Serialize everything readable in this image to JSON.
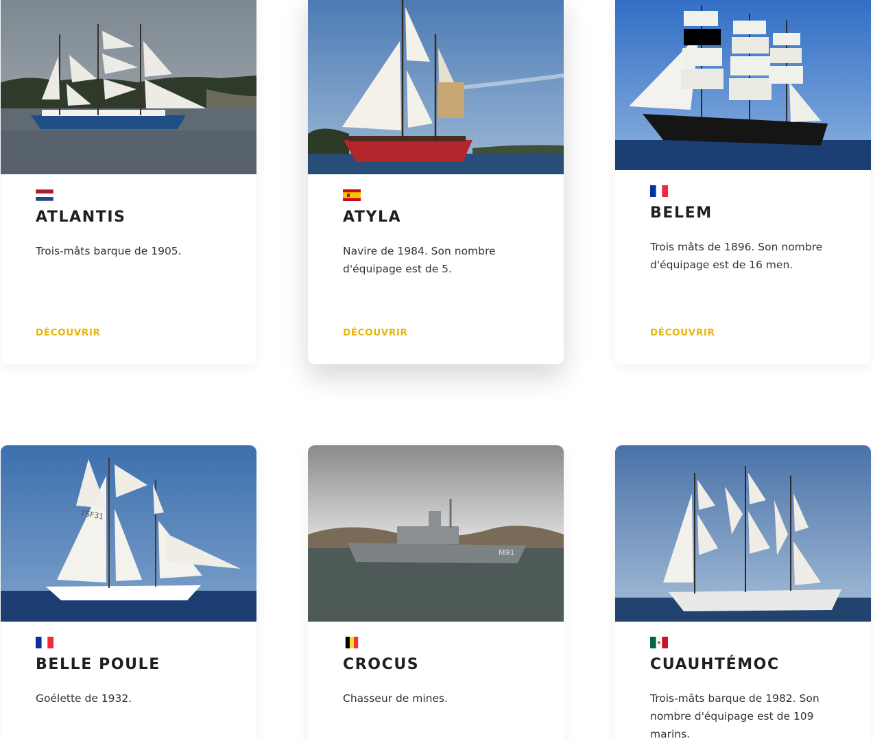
{
  "ships": [
    {
      "name": "ATLANTIS",
      "flag": "netherlands-flag-icon",
      "description": "Trois-mâts barque de 1905.",
      "cta": "DÉCOUVRIR",
      "image": "atlantis-ship-photo"
    },
    {
      "name": "ATYLA",
      "flag": "spain-flag-icon",
      "description": "Navire de 1984. Son nombre d'équipage est de 5.",
      "cta": "DÉCOUVRIR",
      "image": "atyla-ship-photo"
    },
    {
      "name": "BELEM",
      "flag": "france-flag-icon",
      "description": "Trois mâts de 1896. Son nombre d'équipage est de 16 men.",
      "cta": "DÉCOUVRIR",
      "image": "belem-ship-photo"
    },
    {
      "name": "BELLE POULE",
      "flag": "france-flag-icon",
      "description": "Goélette de 1932.",
      "image": "belle-poule-ship-photo"
    },
    {
      "name": "CROCUS",
      "flag": "belgium-flag-icon",
      "description": "Chasseur de mines.",
      "image": "crocus-ship-photo"
    },
    {
      "name": "CUAUHTÉMOC",
      "flag": "mexico-flag-icon",
      "description": "Trois-mâts barque de 1982. Son nombre d'équipage est de 109 marins.",
      "image": "cuauhtemoc-ship-photo"
    }
  ],
  "colors": {
    "accent": "#e8b50e",
    "title": "#1f1f1f",
    "text": "#333333"
  }
}
